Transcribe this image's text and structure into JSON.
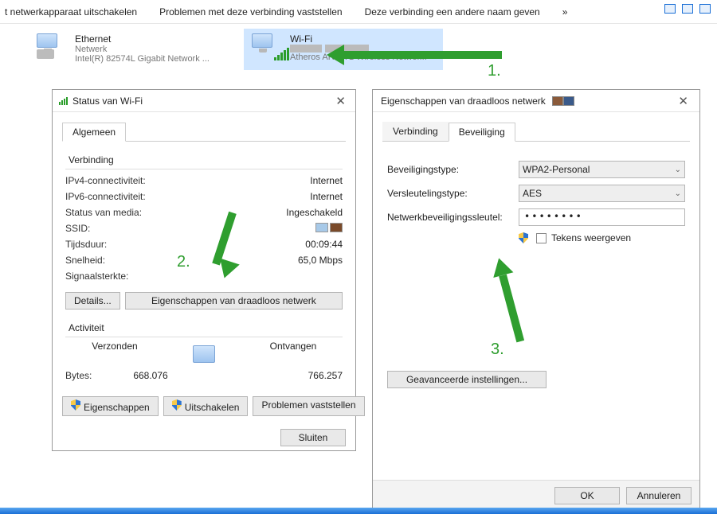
{
  "topbar": {
    "disable": "t netwerkapparaat uitschakelen",
    "diagnose": "Problemen met deze verbinding vaststellen",
    "rename": "Deze verbinding een andere naam geven",
    "more": "»"
  },
  "adapters": {
    "eth": {
      "name": "Ethernet",
      "status": "Netwerk",
      "device": "Intel(R) 82574L Gigabit Network ..."
    },
    "wifi": {
      "name": "Wi-Fi",
      "status": "",
      "device": "Atheros AR9271 Wireless Networ..."
    }
  },
  "statusDialog": {
    "title": "Status van Wi-Fi",
    "tab_general": "Algemeen",
    "group_connection": "Verbinding",
    "ipv4_label": "IPv4-connectiviteit:",
    "ipv4_value": "Internet",
    "ipv6_label": "IPv6-connectiviteit:",
    "ipv6_value": "Internet",
    "media_label": "Status van media:",
    "media_value": "Ingeschakeld",
    "ssid_label": "SSID:",
    "duration_label": "Tijdsduur:",
    "duration_value": "00:09:44",
    "speed_label": "Snelheid:",
    "speed_value": "65,0 Mbps",
    "signal_label": "Signaalsterkte:",
    "btn_details": "Details...",
    "btn_wprops": "Eigenschappen van draadloos netwerk",
    "group_activity": "Activiteit",
    "sent_label": "Verzonden",
    "recv_label": "Ontvangen",
    "bytes_label": "Bytes:",
    "bytes_sent": "668.076",
    "bytes_recv": "766.257",
    "btn_props": "Eigenschappen",
    "btn_disable": "Uitschakelen",
    "btn_diag": "Problemen vaststellen",
    "btn_close": "Sluiten"
  },
  "propsDialog": {
    "title": "Eigenschappen van draadloos netwerk",
    "tab_connection": "Verbinding",
    "tab_security": "Beveiliging",
    "sec_type_label": "Beveiligingstype:",
    "sec_type_value": "WPA2-Personal",
    "enc_type_label": "Versleutelingstype:",
    "enc_type_value": "AES",
    "key_label": "Netwerkbeveiligingssleutel:",
    "key_value": "••••••••",
    "show_chars": "Tekens weergeven",
    "btn_adv": "Geavanceerde instellingen...",
    "btn_ok": "OK",
    "btn_cancel": "Annuleren"
  },
  "annotations": {
    "n1": "1.",
    "n2": "2.",
    "n3": "3."
  }
}
